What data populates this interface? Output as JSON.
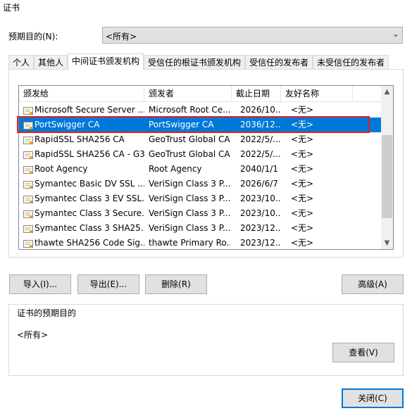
{
  "window": {
    "title": "证书"
  },
  "purpose": {
    "label": "预期目的(N):",
    "value": "<所有>"
  },
  "tabs": [
    {
      "label": "个人"
    },
    {
      "label": "其他人"
    },
    {
      "label": "中间证书颁发机构"
    },
    {
      "label": "受信任的根证书颁发机构"
    },
    {
      "label": "受信任的发布者"
    },
    {
      "label": "未受信任的发布者"
    }
  ],
  "columns": {
    "issued_to": "颁发给",
    "issued_by": "颁发者",
    "expiry": "截止日期",
    "friendly": "友好名称"
  },
  "rows": [
    {
      "issued_to": "Microsoft Secure Server ...",
      "issued_by": "Microsoft Root Ce...",
      "expiry": "2026/10...",
      "friendly": "<无>"
    },
    {
      "issued_to": "PortSwigger CA",
      "issued_by": "PortSwigger CA",
      "expiry": "2036/12...",
      "friendly": "<无>"
    },
    {
      "issued_to": "RapidSSL SHA256 CA",
      "issued_by": "GeoTrust Global CA",
      "expiry": "2022/5/...",
      "friendly": "<无>"
    },
    {
      "issued_to": "RapidSSL SHA256 CA - G3",
      "issued_by": "GeoTrust Global CA",
      "expiry": "2022/5/...",
      "friendly": "<无>"
    },
    {
      "issued_to": "Root Agency",
      "issued_by": "Root Agency",
      "expiry": "2040/1/1",
      "friendly": "<无>"
    },
    {
      "issued_to": "Symantec Basic DV SSL ...",
      "issued_by": "VeriSign Class 3 P...",
      "expiry": "2026/6/7",
      "friendly": "<无>"
    },
    {
      "issued_to": "Symantec Class 3 EV SSL...",
      "issued_by": "VeriSign Class 3 P...",
      "expiry": "2023/10...",
      "friendly": "<无>"
    },
    {
      "issued_to": "Symantec Class 3 Secure...",
      "issued_by": "VeriSign Class 3 P...",
      "expiry": "2023/10...",
      "friendly": "<无>"
    },
    {
      "issued_to": "Symantec Class 3 SHA25...",
      "issued_by": "VeriSign Class 3 P...",
      "expiry": "2023/12...",
      "friendly": "<无>"
    },
    {
      "issued_to": "thawte SHA256 Code Sig...",
      "issued_by": "thawte Primary Ro...",
      "expiry": "2023/12...",
      "friendly": "<无>"
    }
  ],
  "buttons": {
    "import": "导入(I)...",
    "export": "导出(E)...",
    "remove": "删除(R)",
    "advanced": "高级(A)",
    "view": "查看(V)",
    "close": "关闭(C)"
  },
  "group": {
    "title": "证书的预期目的",
    "value": "<所有>"
  },
  "colors": {
    "selection": "#0078d7",
    "highlight_border": "#e02020"
  }
}
